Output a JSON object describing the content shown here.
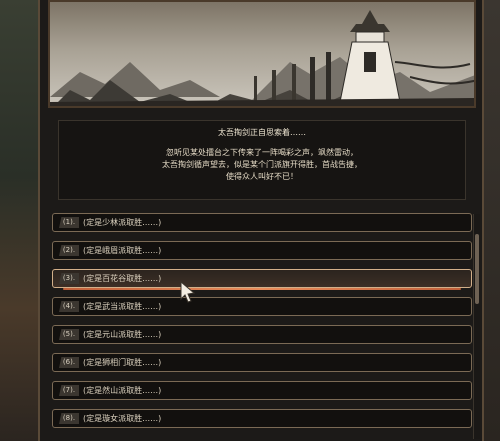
{
  "story": {
    "title": "太吾掏剑正自思索着……",
    "lines": [
      "忽听见某处擂台之下传来了一阵喝彩之声，飒然雷动，",
      "太吾掏剑循声望去，似是某个门派旗开得胜，首战告捷，",
      "使得众人叫好不已！"
    ]
  },
  "options": [
    {
      "num": "(1).",
      "text": "(定是少林派取胜……)"
    },
    {
      "num": "(2).",
      "text": "(定是峨眉派取胜……)"
    },
    {
      "num": "(3).",
      "text": "(定是百花谷取胜……)"
    },
    {
      "num": "(4).",
      "text": "(定是武当派取胜……)"
    },
    {
      "num": "(5).",
      "text": "(定是元山派取胜……)"
    },
    {
      "num": "(6).",
      "text": "(定是狮相门取胜……)"
    },
    {
      "num": "(7).",
      "text": "(定是然山派取胜……)"
    },
    {
      "num": "(8).",
      "text": "(定是璇女派取胜……)"
    }
  ],
  "selected_index": 2,
  "colors": {
    "panel": "#1c1a18",
    "text": "#dcd2bf",
    "highlight": "#e98c5a",
    "border": "#7b6a55"
  }
}
